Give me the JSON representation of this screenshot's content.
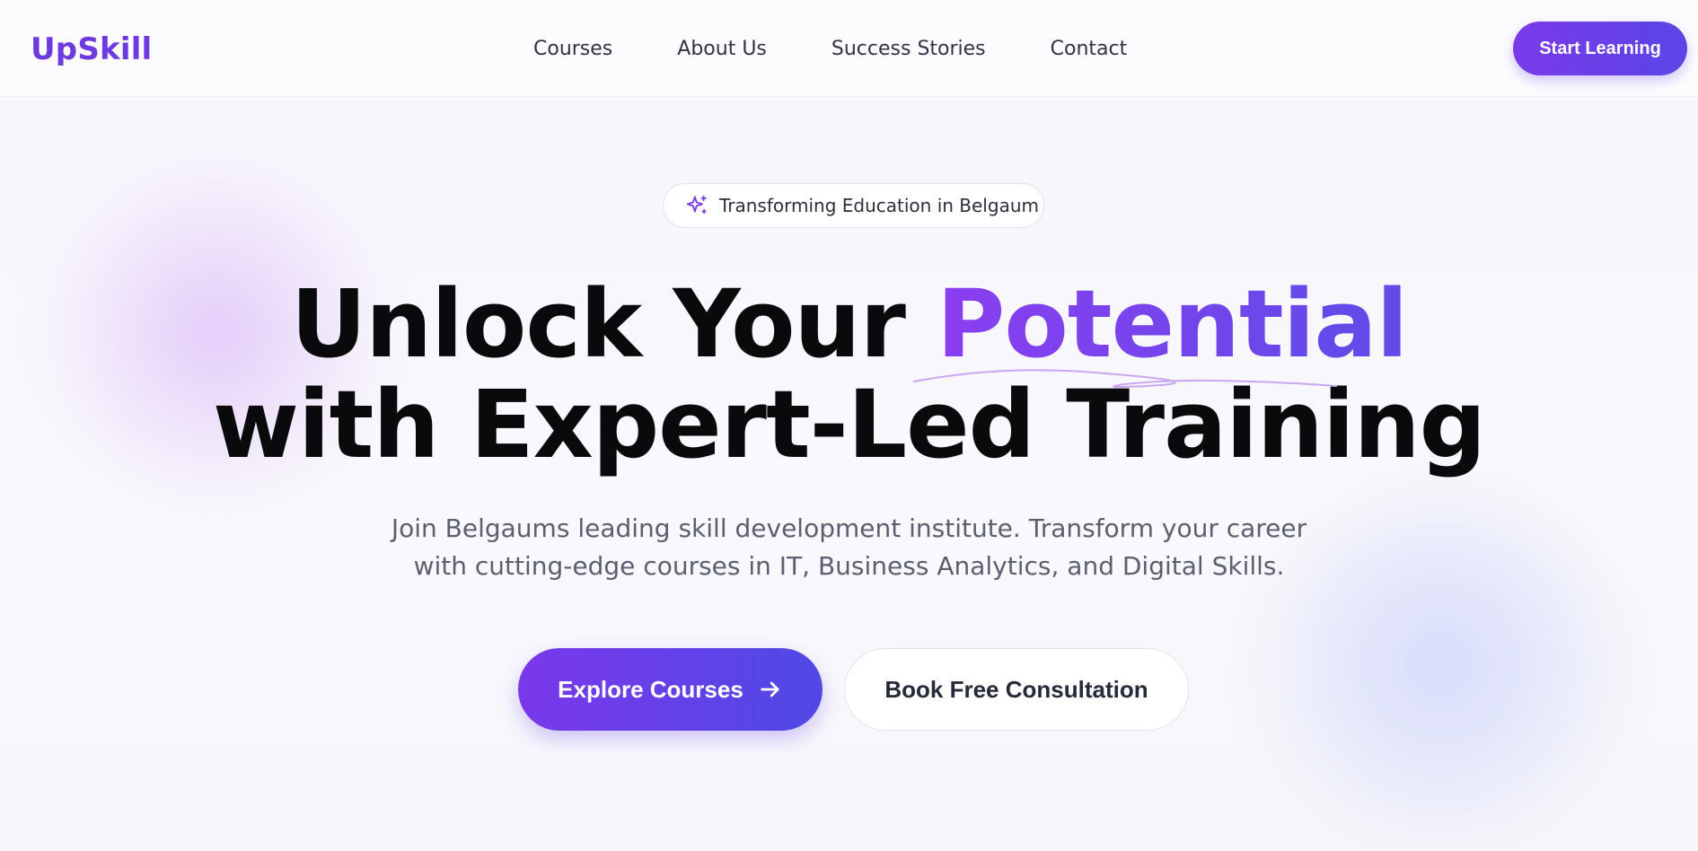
{
  "brand": {
    "logo_text": "UpSkill",
    "accent_color": "#6d3ae0",
    "gradient_start": "#7a3ae8",
    "gradient_end": "#4f49e6"
  },
  "nav": {
    "items": [
      {
        "label": "Courses"
      },
      {
        "label": "About Us"
      },
      {
        "label": "Success Stories"
      },
      {
        "label": "Contact"
      }
    ],
    "cta_label": "Start Learning"
  },
  "hero": {
    "badge": {
      "icon": "sparkle-icon",
      "text": "Transforming Education in Belgaum"
    },
    "headline": {
      "part1": "Unlock Your ",
      "accent": "Potential",
      "line2": "with Expert-Led Training"
    },
    "subtitle": {
      "line1": "Join Belgaums leading skill development institute. Transform your career",
      "line2": "with cutting-edge courses in IT, Business Analytics, and Digital Skills."
    },
    "primary_button": {
      "label": "Explore Courses",
      "icon": "arrow-right-icon"
    },
    "secondary_button": {
      "label": "Book Free Consultation"
    }
  }
}
